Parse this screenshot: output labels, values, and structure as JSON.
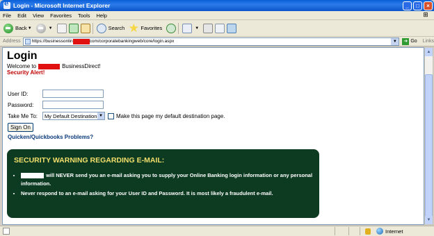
{
  "window": {
    "title": "Login - Microsoft Internet Explorer"
  },
  "menu": [
    "File",
    "Edit",
    "View",
    "Favorites",
    "Tools",
    "Help"
  ],
  "toolbar": {
    "back": "Back",
    "search": "Search",
    "favorites": "Favorites"
  },
  "address": {
    "label": "Address",
    "url_prefix": "https://businessonlin",
    "url_suffix": "com/corporatebankingweb/core/login.aspx",
    "go": "Go",
    "links": "Links"
  },
  "page": {
    "title": "Login",
    "welcome_prefix": "Welcome to",
    "welcome_suffix": "BusinessDirect!",
    "alert": "Security Alert!",
    "user_id_label": "User ID:",
    "password_label": "Password:",
    "take_me_to_label": "Take Me To:",
    "destination_value": "My Default Destination",
    "default_checkbox_label": "Make this page my default destination page.",
    "sign_on": "Sign On",
    "quicken_link": "Quicken/Quickbooks Problems?"
  },
  "warning": {
    "title": "SECURITY WARNING REGARDING E-MAIL:",
    "bullet1": "will NEVER send you an e-mail asking you to supply your Online Banking login information or any personal information.",
    "bullet2": "Never respond to an e-mail asking for your User ID and Password. It is most likely a fraudulent e-mail."
  },
  "status": {
    "zone": "Internet"
  }
}
